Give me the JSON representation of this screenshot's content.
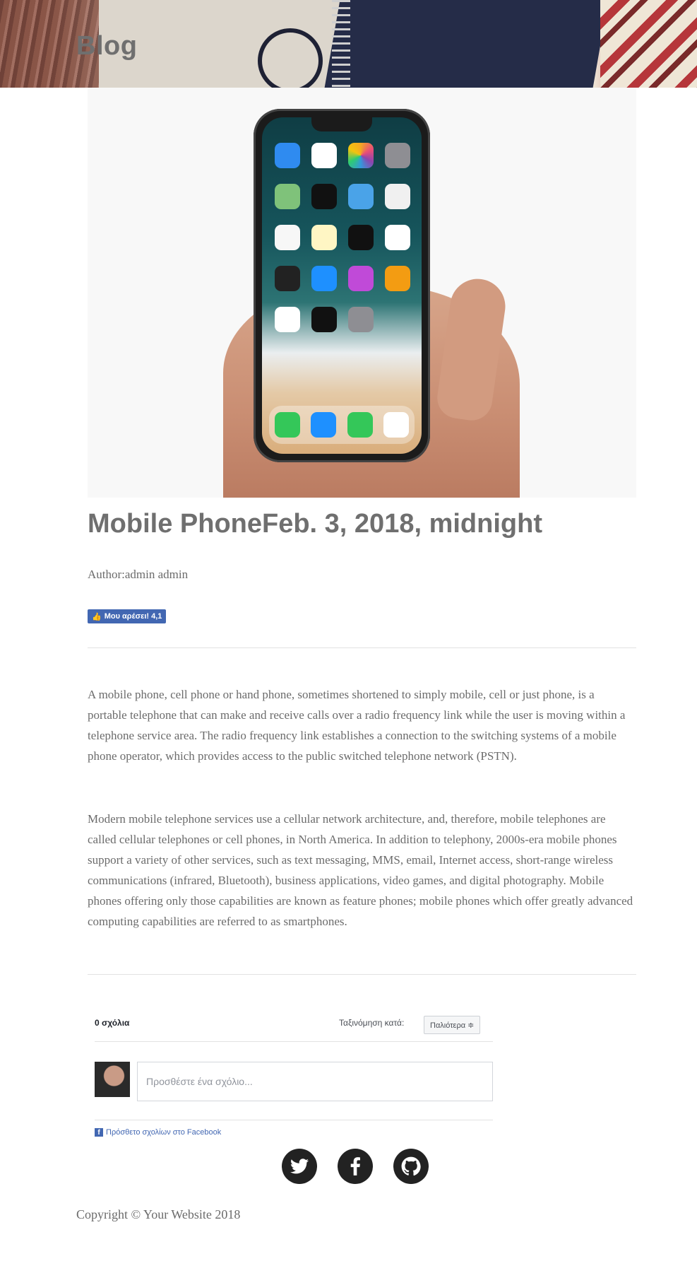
{
  "header": {
    "title": "Blog"
  },
  "post": {
    "title": "Mobile PhoneFeb. 3, 2018, midnight",
    "author": "Author:admin admin",
    "like_label": "Μου αρέσει! 4,1",
    "paragraphs": [
      "A mobile phone, cell phone or hand phone, sometimes shortened to simply mobile, cell or just phone, is a portable telephone that can make and receive calls over a radio frequency link while the user is moving within a telephone service area. The radio frequency link establishes a connection to the switching systems of a mobile phone operator, which provides access to the public switched telephone network (PSTN).",
      "Modern mobile telephone services use a cellular network architecture, and, therefore, mobile telephones are called cellular telephones or cell phones, in North America. In addition to telephony, 2000s-era mobile phones support a variety of other services, such as text messaging, MMS, email, Internet access, short-range wireless communications (infrared, Bluetooth), business applications, video games, and digital photography. Mobile phones offering only those capabilities are known as feature phones; mobile phones which offer greatly advanced computing capabilities are referred to as smartphones."
    ]
  },
  "comments": {
    "count_label": "0 σχόλια",
    "sort_label": "Ταξινόμηση κατά:",
    "sort_value": "Παλιότερα ≑",
    "placeholder": "Προσθέστε ένα σχόλιο...",
    "plugin_label": "Πρόσθετο σχολίων στο Facebook"
  },
  "social": [
    "twitter-icon",
    "facebook-icon",
    "github-icon"
  ],
  "footer": {
    "copyright": "Copyright © Your Website 2018"
  },
  "colors": {
    "accent_fb": "#4267b2",
    "text": "#6b6b6b",
    "social_bg": "#222222"
  }
}
